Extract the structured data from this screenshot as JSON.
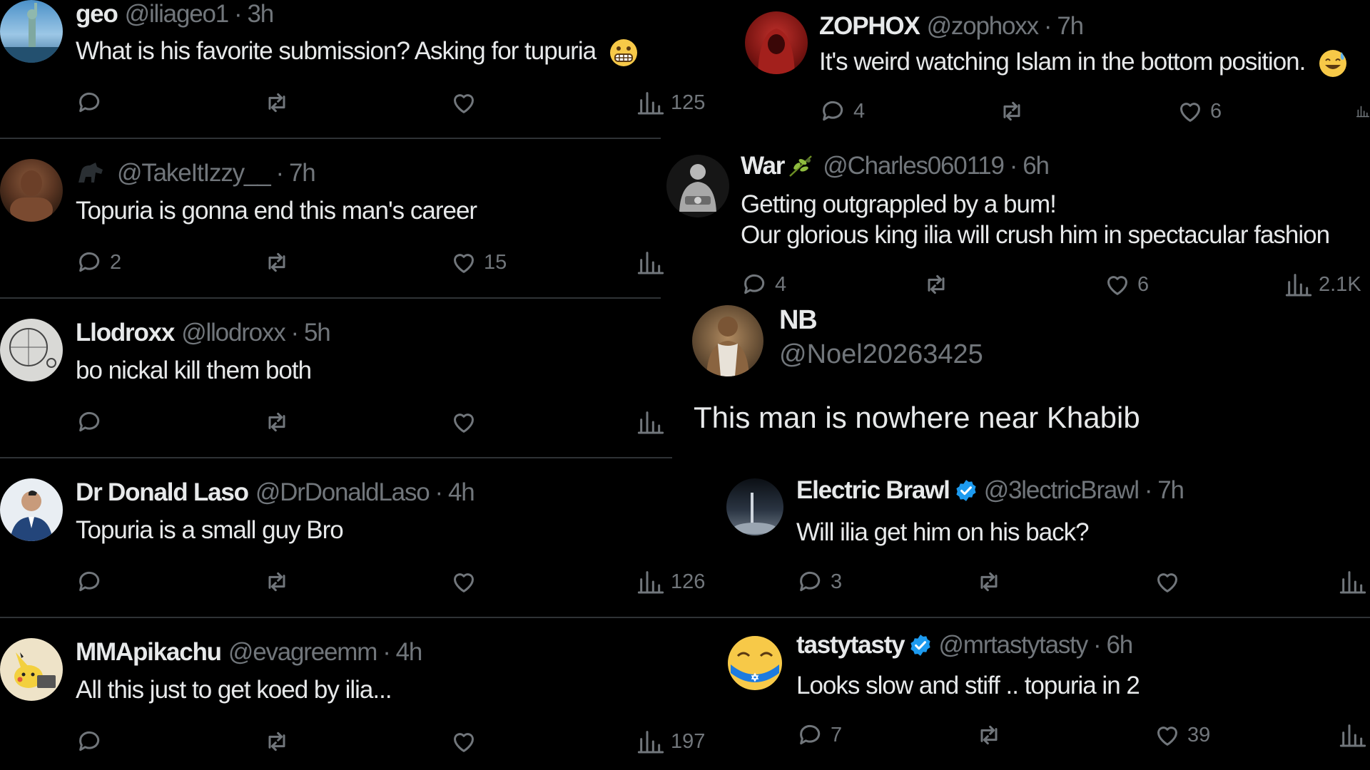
{
  "left_column": [
    {
      "name": "geo",
      "handle": "@iliageo1",
      "time": "3h",
      "text": "What is his favorite submission? Asking for tupuria",
      "emoji": "grimace-emoji",
      "replies": "",
      "reposts": "",
      "likes": "",
      "views": "125"
    },
    {
      "name": "",
      "handle": "@TakeItIzzy__",
      "time": "7h",
      "text": "Topuria is gonna end this man's career",
      "emoji": "",
      "replies": "2",
      "reposts": "",
      "likes": "15",
      "views": ""
    },
    {
      "name": "Llodroxx",
      "handle": "@llodroxx",
      "time": "5h",
      "text": "bo nickal kill them both",
      "emoji": "",
      "replies": "",
      "reposts": "",
      "likes": "",
      "views": ""
    },
    {
      "name": "Dr Donald Laso",
      "handle": "@DrDonaldLaso",
      "time": "4h",
      "text": "Topuria is a small guy Bro",
      "emoji": "",
      "replies": "",
      "reposts": "",
      "likes": "",
      "views": "126"
    },
    {
      "name": "MMApikachu",
      "handle": "@evagreemm",
      "time": "4h",
      "text": "All this just to get koed by ilia...",
      "emoji": "",
      "replies": "",
      "reposts": "",
      "likes": "",
      "views": "197"
    }
  ],
  "right_column": {
    "zophox": {
      "name": "ZOPHOX",
      "handle": "@zophoxx",
      "time": "7h",
      "text": "It's weird watching Islam in the bottom position.",
      "emoji": "sweat-smile-emoji",
      "replies": "4",
      "likes": "6"
    },
    "war": {
      "name": "War",
      "handle": "@Charles060119",
      "time": "6h",
      "line1": "Getting outgrappled by a bum!",
      "line2": "Our glorious king ilia will crush him in spectacular fashion",
      "emoji": "olive-branch-emoji",
      "replies": "4",
      "likes": "6",
      "views": "2.1K"
    },
    "nb": {
      "name": "NB",
      "handle": "@Noel20263425",
      "text": "This man is nowhere near Khabib"
    },
    "electric": {
      "name": "Electric Brawl",
      "handle": "@3lectricBrawl",
      "time": "7h",
      "text": "Will ilia get him on his back?",
      "replies": "3",
      "likes": ""
    },
    "tasty": {
      "name": "tastytasty",
      "handle": "@mrtastytasty",
      "time": "6h",
      "text": "Looks slow and stiff .. topuria in 2",
      "replies": "7",
      "likes": "39"
    }
  },
  "colors": {
    "background": "#000000",
    "text": "#e7e9ea",
    "muted": "#71767b",
    "verified": "#1d9bf0",
    "divider": "#2f3336"
  }
}
